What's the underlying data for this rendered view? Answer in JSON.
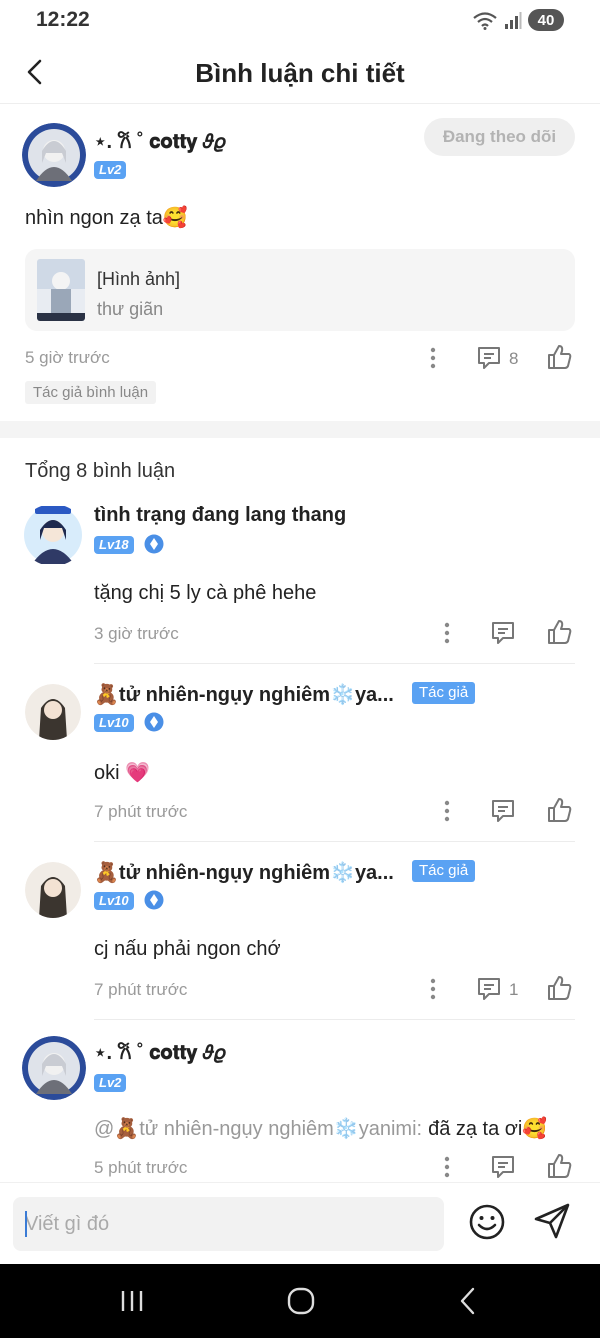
{
  "status": {
    "time": "12:22",
    "battery": "40"
  },
  "header": {
    "title": "Bình luận chi tiết"
  },
  "main": {
    "author": "⋆. 𐙚 ˚ 𝐜𝐨𝐭𝐭𝐲 𝜗𝜚",
    "level": "Lv2",
    "follow_label": "Đang theo dõi",
    "text": "nhìn ngon zạ ta🥰",
    "quote_title": "[Hình ảnh]",
    "quote_subtitle": "thư giãn",
    "time": "5 giờ trước",
    "comment_count": "8",
    "author_tag": "Tác giả bình luận"
  },
  "total_label": "Tổng 8 bình luận",
  "replies": [
    {
      "name": "tình trạng đang lang thang",
      "level": "Lv18",
      "text": "tặng chị 5 ly cà phê hehe",
      "time": "3 giờ trước",
      "count": "",
      "tag": ""
    },
    {
      "name": "🧸tử nhiên-ngụy nghiêm❄️ya...",
      "level": "Lv10",
      "text": "oki 💗",
      "time": "7 phút trước",
      "count": "",
      "tag": "Tác giả"
    },
    {
      "name": "🧸tử nhiên-ngụy nghiêm❄️ya...",
      "level": "Lv10",
      "text": "cj nấu phải ngon chớ",
      "time": "7 phút trước",
      "count": "1",
      "tag": "Tác giả"
    },
    {
      "name": "⋆. 𐙚 ˚ 𝐜𝐨𝐭𝐭𝐲 𝜗𝜚",
      "level": "Lv2",
      "text": "đã zạ ta ơi🥰",
      "mention": "@🧸tử nhiên-ngụy nghiêm❄️yanimi:",
      "time": "5 phút trước",
      "count": "",
      "tag": ""
    }
  ],
  "input": {
    "placeholder": "Viết gì đó"
  },
  "colors": {
    "accent": "#5aa2f3",
    "muted": "#9a9a9a"
  }
}
